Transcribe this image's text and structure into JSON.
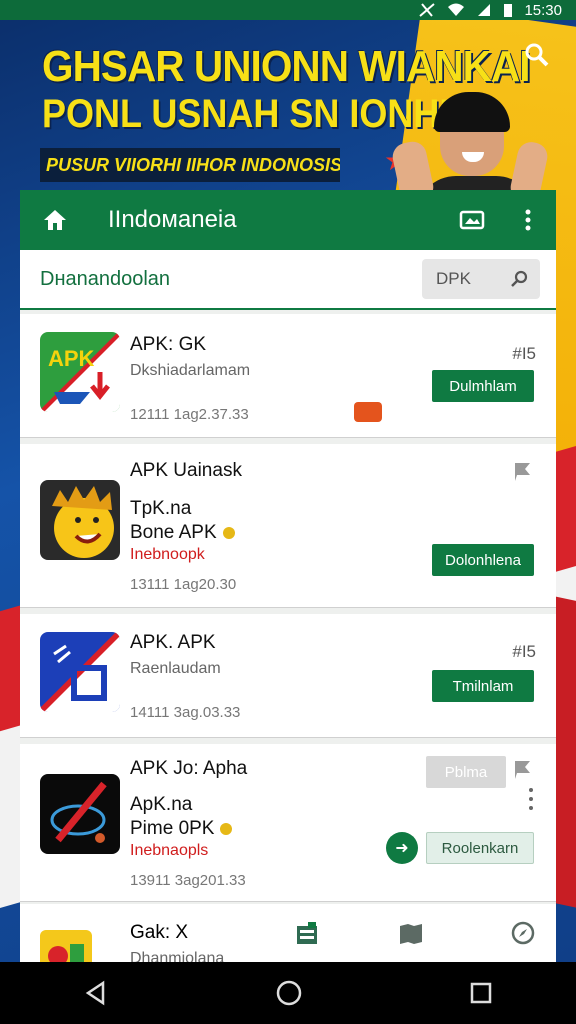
{
  "status_bar": {
    "time": "15:30"
  },
  "banner": {
    "headline_1": "GHSAR UNIONN WIANKAI",
    "headline_2": "PONL USNAH SN IONHH",
    "strip_text": "PUSUR VIIORHI IIHOR INDONOSIS"
  },
  "app_bar": {
    "title": "IIndомanеia"
  },
  "search": {
    "label": "Dнanandoolan",
    "placeholder": "DPK"
  },
  "apps": [
    {
      "name": "APK: GK",
      "subtitle": "Dkshiadarlamam",
      "meta": "12111 1ag2.37.33",
      "size": "#I5",
      "button": "Dulmhlam"
    },
    {
      "name": "APK Uainask",
      "developer_1": "TpK.na",
      "developer_2": "Bone APK",
      "tag": "Inebnoopk",
      "meta": "13111 1ag20.30",
      "button": "Dolonhlena"
    },
    {
      "name": "APK. APK",
      "subtitle": "Raenlaudam",
      "meta": "14111 3ag.03.33",
      "size": "#I5",
      "button": "Tmilnlam"
    },
    {
      "name": "APK Jo: Apha",
      "developer_1": "ApK.na",
      "developer_2": "Pime 0PK",
      "tag": "Inebnaopls",
      "meta": "13911 3ag201.33",
      "button_top": "Pblma",
      "button": "Roolenkarn"
    },
    {
      "name": "Gak: X",
      "subtitle": "Dhanmiolana"
    }
  ],
  "colors": {
    "brand_green": "#0f7a42",
    "status_bar": "#0d6b3a",
    "banner_yellow": "#f7e017"
  }
}
